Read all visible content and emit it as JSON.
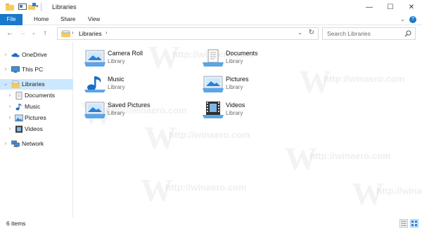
{
  "window": {
    "title": "Libraries",
    "controls": {
      "minimize": "—",
      "maximize": "☐",
      "close": "✕"
    }
  },
  "ribbon": {
    "tabs": [
      "File",
      "Home",
      "Share",
      "View"
    ],
    "expand_icon": "chevron-down-icon",
    "help_icon": "?"
  },
  "address_bar": {
    "path": [
      "Libraries"
    ],
    "search_placeholder": "Search Libraries"
  },
  "nav_pane": {
    "items": [
      {
        "label": "OneDrive",
        "icon": "cloud-icon",
        "level": 0,
        "expandable": true,
        "selected": false
      },
      {
        "label": "This PC",
        "icon": "computer-icon",
        "level": 0,
        "expandable": true,
        "selected": false
      },
      {
        "label": "Libraries",
        "icon": "libraries-icon",
        "level": 0,
        "expandable": true,
        "expanded": true,
        "selected": true
      },
      {
        "label": "Documents",
        "icon": "documents-icon",
        "level": 1,
        "expandable": true,
        "selected": false
      },
      {
        "label": "Music",
        "icon": "music-icon",
        "level": 1,
        "expandable": true,
        "selected": false
      },
      {
        "label": "Pictures",
        "icon": "pictures-icon",
        "level": 1,
        "expandable": true,
        "selected": false
      },
      {
        "label": "Videos",
        "icon": "videos-icon",
        "level": 1,
        "expandable": true,
        "selected": false
      },
      {
        "label": "Network",
        "icon": "network-icon",
        "level": 0,
        "expandable": true,
        "selected": false
      }
    ]
  },
  "content": {
    "libraries": [
      {
        "name": "Camera Roll",
        "type": "Library",
        "icon": "camera-roll-library-icon"
      },
      {
        "name": "Documents",
        "type": "Library",
        "icon": "documents-library-icon"
      },
      {
        "name": "Music",
        "type": "Library",
        "icon": "music-library-icon"
      },
      {
        "name": "Pictures",
        "type": "Library",
        "icon": "pictures-library-icon"
      },
      {
        "name": "Saved Pictures",
        "type": "Library",
        "icon": "saved-pictures-library-icon"
      },
      {
        "name": "Videos",
        "type": "Library",
        "icon": "videos-library-icon"
      }
    ]
  },
  "watermark": {
    "text": "http://winaero.com"
  },
  "status_bar": {
    "item_count": "6 items"
  },
  "colors": {
    "accent": "#1979ca",
    "selection": "#cce8ff",
    "secondary_text": "#6d6d6d"
  }
}
